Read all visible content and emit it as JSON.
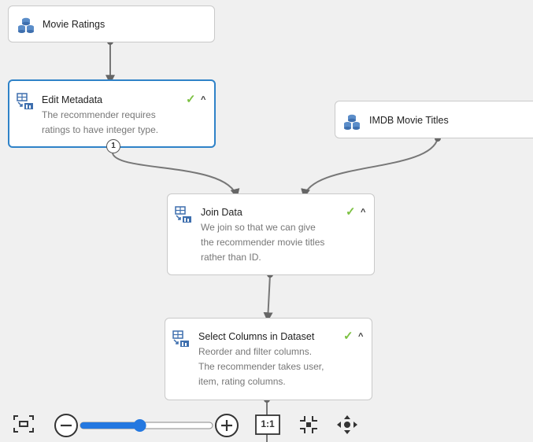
{
  "colors": {
    "canvas_bg": "#f0f0f0",
    "node_bg": "#ffffff",
    "node_border": "#c9c9c9",
    "selected_border": "#2f82c8",
    "connector": "#777777",
    "check": "#7cc142",
    "zoom_accent": "#2478e0"
  },
  "nodes": {
    "movie_ratings": {
      "title": "Movie Ratings",
      "icon": "dataset-icon"
    },
    "edit_metadata": {
      "title": "Edit Metadata",
      "description_line1": "The recommender requires",
      "description_line2": "ratings to have integer type.",
      "icon": "module-icon",
      "status": "completed",
      "output_port_label": "1"
    },
    "imdb_titles": {
      "title": "IMDB Movie Titles",
      "icon": "dataset-icon"
    },
    "join_data": {
      "title": "Join Data",
      "description_line1": "We join so that we can give",
      "description_line2": "the recommender movie titles",
      "description_line3": "rather than ID.",
      "icon": "module-icon",
      "status": "completed"
    },
    "select_columns": {
      "title": "Select Columns in Dataset",
      "description_line1": "Reorder and filter columns.",
      "description_line2": "The recommender takes user,",
      "description_line3": "item, rating columns.",
      "icon": "module-icon",
      "status": "completed"
    }
  },
  "toolbar": {
    "fit_icon": "fit-to-screen-icon",
    "zoom_out_icon": "zoom-out-icon",
    "zoom_in_icon": "zoom-in-icon",
    "zoom_level": 0.45,
    "actual_size_label": "1:1",
    "actual_size_icon": "actual-size-icon",
    "center_icon": "center-icon",
    "pan_icon": "pan-icon"
  }
}
